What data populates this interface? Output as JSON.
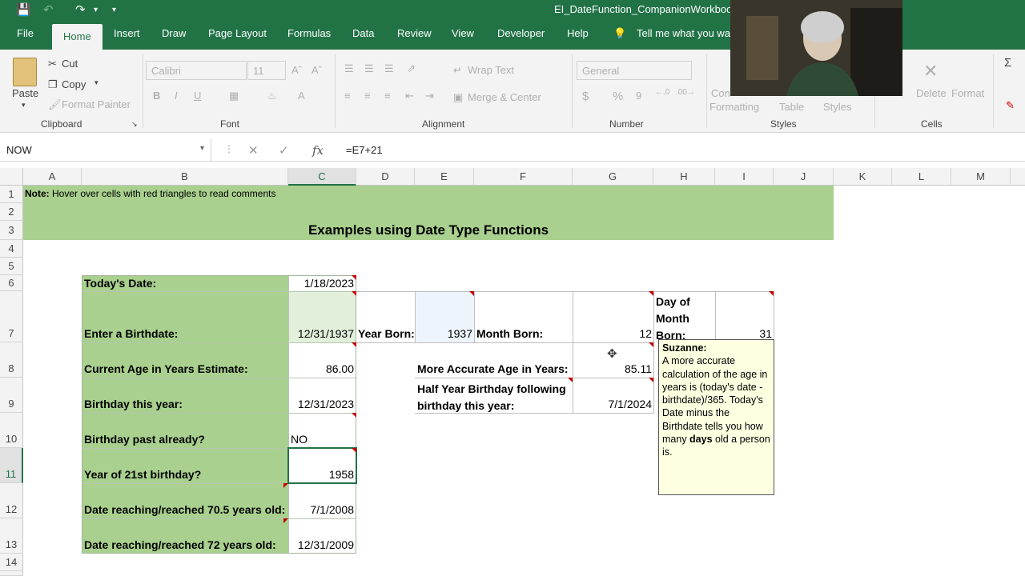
{
  "titlebar": {
    "title": "EI_DateFunction_CompanionWorkboo"
  },
  "menu": {
    "tabs": [
      "File",
      "Home",
      "Insert",
      "Draw",
      "Page Layout",
      "Formulas",
      "Data",
      "Review",
      "View",
      "Developer",
      "Help"
    ],
    "tell_me": "Tell me what you wa"
  },
  "ribbon": {
    "paste": "Paste",
    "cut": "Cut",
    "copy": "Copy",
    "format_painter": "Format Painter",
    "font_name": "Calibri",
    "font_size": "11",
    "bold": "B",
    "italic": "I",
    "underline": "U",
    "wrap_text": "Wrap Text",
    "merge_center": "Merge & Center",
    "number_format": "General",
    "currency": "$",
    "percent": "%",
    "comma": "9",
    "cond_formatting": "Con",
    "formatting": "Formatting",
    "table": "Table",
    "styles_btn": "Styles",
    "delete": "Delete",
    "format": "Format",
    "groups": {
      "clipboard": "Clipboard",
      "font": "Font",
      "alignment": "Alignment",
      "number": "Number",
      "styles": "Styles",
      "cells": "Cells"
    }
  },
  "formula_bar": {
    "name_box": "NOW",
    "fx": "fx",
    "formula": "=E7+21"
  },
  "columns": [
    "A",
    "B",
    "C",
    "D",
    "E",
    "F",
    "G",
    "H",
    "I",
    "J",
    "K",
    "L",
    "M"
  ],
  "rows": [
    "1",
    "2",
    "3",
    "4",
    "5",
    "6",
    "7",
    "8",
    "9",
    "10",
    "11",
    "12",
    "13",
    "14"
  ],
  "sheet": {
    "note_bold": "Note:",
    "note_text": "Hover over cells with red triangles to read comments",
    "heading": "Examples using Date Type Functions",
    "labels": {
      "b6": "Today's Date:",
      "b7": "Enter a Birthdate:",
      "b8": "Current Age in Years Estimate:",
      "b9": "Birthday this year:",
      "b10": "Birthday past already?",
      "b11": "Year of 21st birthday?",
      "b12": "Date reaching/reached 70.5 years old:",
      "b13": "Date reaching/reached 72 years old:"
    },
    "values": {
      "c6": "1/18/2023",
      "c7": "12/31/1937",
      "c8": "86.00",
      "c9": "12/31/2023",
      "c10": "NO",
      "c11": "1958",
      "c12": "7/1/2008",
      "c13": "12/31/2009"
    },
    "d7": "Year Born:",
    "e7": "1937",
    "f7": "Month Born:",
    "g7": "12",
    "h7_line1": "Day of",
    "h7_line2": "Month",
    "h7_line3": "Born:",
    "i7": "31",
    "e8": "More Accurate Age in Years:",
    "g8": "85.11",
    "e9_line1": "Half Year Birthday following",
    "e9_line2": "birthday this year:",
    "g9": "7/1/2024"
  },
  "comment": {
    "author": "Suzanne:",
    "text_before": "A more accurate calculation of the age in years is (today's date - birthdate)/365. Today's Date minus the Birthdate tells you how many ",
    "bold_word": "days",
    "text_after": " old a person is."
  }
}
